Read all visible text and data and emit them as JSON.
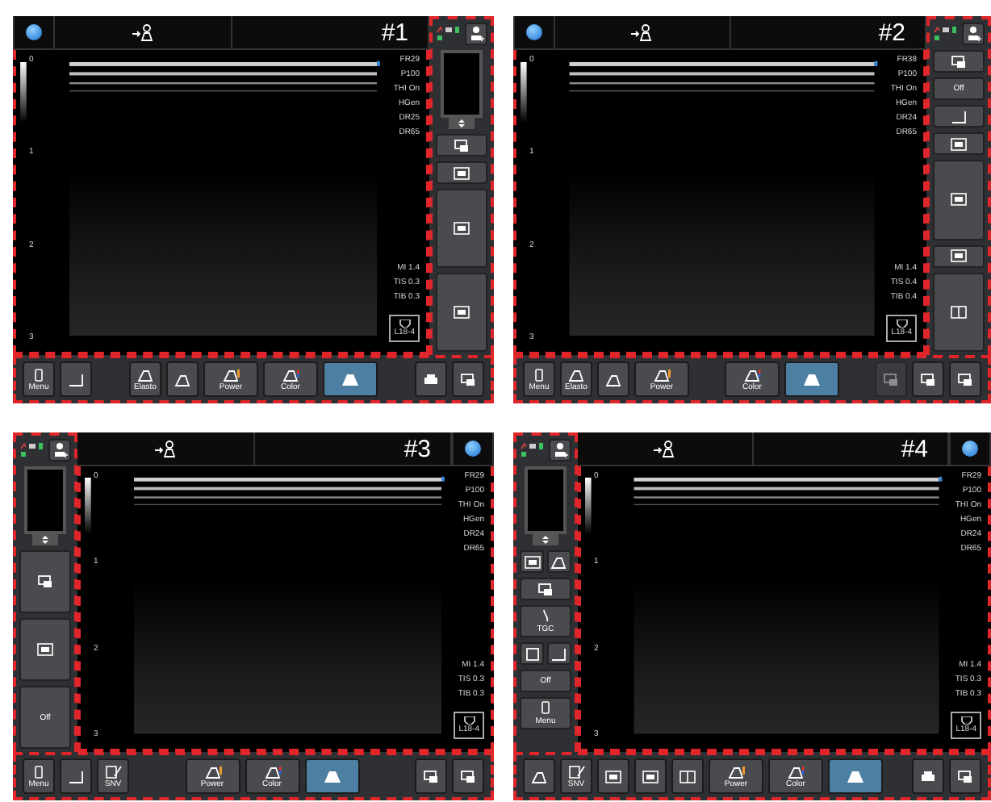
{
  "panels": [
    {
      "label": "#1",
      "kind": "right-panel",
      "params": [
        "FR29",
        "P100",
        "THI On",
        "HGen",
        "DR25",
        "DR65"
      ],
      "safety": [
        "MI 1.4",
        "TIS 0.3",
        "TIB 0.3"
      ],
      "probe": "L18-4",
      "depth": [
        "0",
        "1",
        "2",
        "3"
      ],
      "side": [
        {
          "kind": "preview"
        },
        {
          "kind": "recall"
        },
        {
          "kind": "layout"
        },
        {
          "kind": "split-top"
        },
        {
          "kind": "split-bottom"
        }
      ],
      "toolbar": {
        "left": [
          {
            "kind": "menu",
            "label": "Menu",
            "selected": false
          },
          {
            "kind": "measure",
            "selected": false
          }
        ],
        "center": [
          {
            "kind": "elasto",
            "label": "Elasto",
            "selected": false
          },
          {
            "kind": "scf",
            "selected": false
          },
          {
            "kind": "power",
            "label": "Power",
            "selected": false
          },
          {
            "kind": "color",
            "label": "Color",
            "selected": false
          },
          {
            "kind": "bmode",
            "selected": true
          }
        ],
        "right": [
          {
            "kind": "print",
            "selected": false
          },
          {
            "kind": "save",
            "selected": false
          }
        ]
      }
    },
    {
      "label": "#2",
      "kind": "right-panel",
      "params": [
        "FR38",
        "P100",
        "THI On",
        "HGen",
        "DR24",
        "DR65"
      ],
      "safety": [
        "MI 1.4",
        "TIS 0.4",
        "TIB 0.4"
      ],
      "probe": "L18-4",
      "depth": [
        "0",
        "1",
        "2",
        "3"
      ],
      "side": [
        {
          "kind": "recall"
        },
        {
          "kind": "toggle",
          "label": "Off"
        },
        {
          "kind": "measure"
        },
        {
          "kind": "layout"
        },
        {
          "kind": "split-top"
        },
        {
          "kind": "split-right"
        },
        {
          "kind": "dual"
        }
      ],
      "toolbar": {
        "left": [
          {
            "kind": "menu",
            "label": "Menu",
            "selected": false
          },
          {
            "kind": "elasto",
            "label": "Elasto",
            "selected": false
          },
          {
            "kind": "scf",
            "selected": false
          },
          {
            "kind": "power",
            "label": "Power",
            "selected": false
          }
        ],
        "center": [
          {
            "kind": "color",
            "label": "Color",
            "selected": false
          },
          {
            "kind": "bmode",
            "selected": true
          }
        ],
        "right": [
          {
            "kind": "cine",
            "selected": false,
            "disabled": true
          },
          {
            "kind": "imgsave",
            "selected": false
          },
          {
            "kind": "stillsave",
            "selected": false
          }
        ]
      }
    },
    {
      "label": "#3",
      "kind": "left-panel",
      "params": [
        "FR29",
        "P100",
        "THI On",
        "HGen",
        "DR24",
        "DR65"
      ],
      "safety": [
        "MI 1.4",
        "TIS 0.3",
        "TIB 0.3"
      ],
      "probe": "L18-4",
      "depth": [
        "0",
        "1",
        "2",
        "3"
      ],
      "side": [
        {
          "kind": "preview"
        },
        {
          "kind": "recall-big"
        },
        {
          "kind": "layout-big"
        },
        {
          "kind": "toggle-big",
          "label": "Off"
        }
      ],
      "toolbar": {
        "left": [
          {
            "kind": "menu",
            "label": "Menu",
            "selected": false
          },
          {
            "kind": "measure",
            "selected": false
          },
          {
            "kind": "snv",
            "label": "SNV",
            "selected": false
          }
        ],
        "center": [
          {
            "kind": "power",
            "label": "Power",
            "selected": false
          },
          {
            "kind": "color",
            "label": "Color",
            "selected": false
          },
          {
            "kind": "bmode",
            "selected": true
          }
        ],
        "right": [
          {
            "kind": "stillsave",
            "selected": false
          },
          {
            "kind": "imgsave",
            "selected": false
          }
        ]
      }
    },
    {
      "label": "#4",
      "kind": "left-panel",
      "params": [
        "FR29",
        "P100",
        "THI On",
        "HGen",
        "DR24",
        "DR65"
      ],
      "safety": [
        "MI 1.4",
        "TIS 0.3",
        "TIB 0.3"
      ],
      "probe": "L18-4",
      "depth": [
        "0",
        "1",
        "2",
        "3"
      ],
      "side": [
        {
          "kind": "preview"
        },
        {
          "kind": "review"
        },
        {
          "kind": "bodymark-small"
        },
        {
          "kind": "recall"
        },
        {
          "kind": "tgc",
          "label": "TGC"
        },
        {
          "kind": "textmark"
        },
        {
          "kind": "measure-small"
        },
        {
          "kind": "toggle",
          "label": "Off"
        },
        {
          "kind": "menu",
          "label": "Menu"
        }
      ],
      "toolbar": {
        "left": [
          {
            "kind": "bodymark",
            "selected": false
          },
          {
            "kind": "snv",
            "label": "SNV",
            "selected": false
          },
          {
            "kind": "layout",
            "selected": false
          },
          {
            "kind": "split",
            "selected": false
          },
          {
            "kind": "dual",
            "selected": false
          },
          {
            "kind": "power",
            "label": "Power",
            "selected": false
          },
          {
            "kind": "color",
            "label": "Color",
            "selected": false
          },
          {
            "kind": "bmode",
            "selected": true
          }
        ],
        "right": [
          {
            "kind": "print",
            "selected": false
          },
          {
            "kind": "save",
            "selected": false
          }
        ]
      }
    }
  ]
}
